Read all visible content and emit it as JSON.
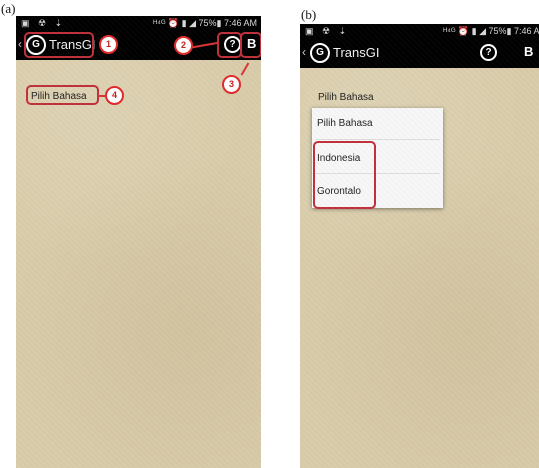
{
  "labels": {
    "a": "(a)",
    "b": "(b)"
  },
  "status": {
    "left_icons": "▣ ☢ ⇣",
    "right_text": "ᴴ⁴ᴳ ⏰ ▮ ◢ 75%▮ 7:46 AM",
    "right_text_b": "ᴴ⁴ᴳ ⏰ ▮ ◢ 75%▮ 7:46 AM"
  },
  "app": {
    "back": "‹",
    "logo": "G",
    "title": "TransGI",
    "help": "?",
    "b_label": "B"
  },
  "screen_a": {
    "spinner": "Pilih Bahasa",
    "callouts": [
      "1",
      "2",
      "3",
      "4"
    ]
  },
  "screen_b": {
    "spinner": "Pilih Bahasa",
    "options": [
      "Pilih Bahasa",
      "Indonesia",
      "Gorontalo"
    ]
  },
  "colors": {
    "annotation": "#c0303a",
    "appbar": "#000000",
    "background": "#d9ccaa"
  }
}
